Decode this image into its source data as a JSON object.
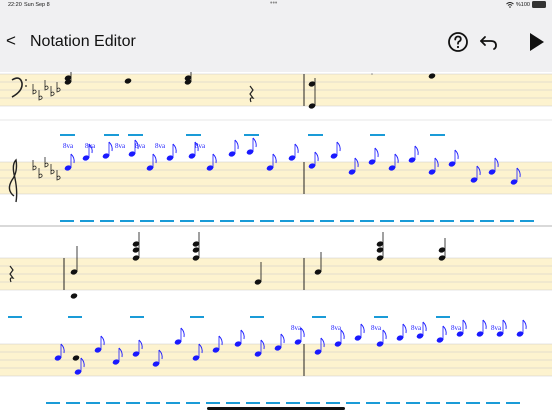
{
  "status": {
    "time": "22:20",
    "date": "Sun Sep 8",
    "dots": "•••",
    "battery": "%100"
  },
  "nav": {
    "back_label": "<",
    "title": "Notation Editor"
  },
  "icons": {
    "back": "chevron-left-icon",
    "help": "question-circle-icon",
    "undo": "undo-arrow-icon",
    "play": "play-icon"
  },
  "colors": {
    "accent": "#1a9bd7",
    "notes": "#1a1aff",
    "staff_band": "#fdf3cf",
    "hint": "#b0b0b0"
  },
  "score": {
    "octave_mark": "8va"
  }
}
